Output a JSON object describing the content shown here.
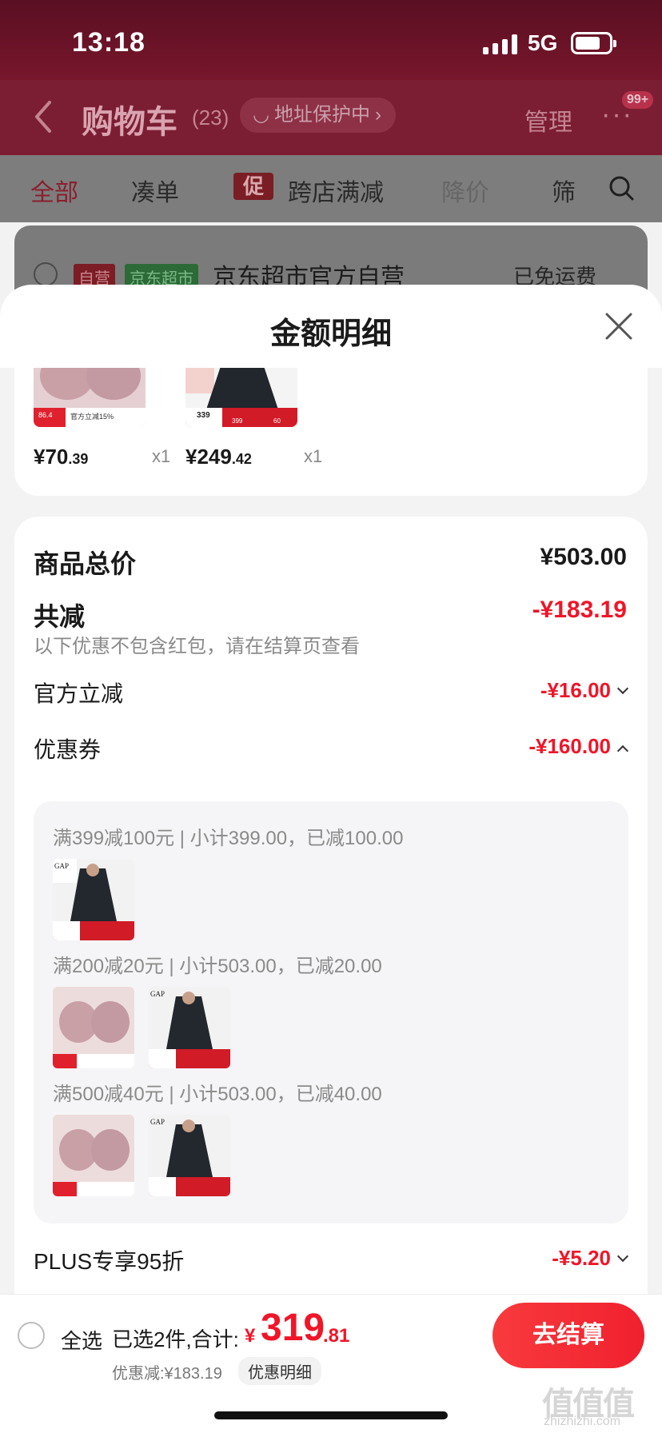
{
  "status": {
    "time": "13:18",
    "network": "5G"
  },
  "cart": {
    "title": "购物车",
    "count": "(23)",
    "address_protect": "地址保护中",
    "manage": "管理",
    "badge": "99+",
    "filters": {
      "all": "全部",
      "cou": "凑单",
      "promo_tag": "促",
      "cross_shop": "跨店满减",
      "price_drop": "降价",
      "screen": "筛"
    },
    "shop": {
      "tag_ziying": "自营",
      "tag_jd": "京东超市",
      "name": "京东超市官方自营",
      "free_shipping": "已免运费"
    }
  },
  "sheet": {
    "title": "金额明细",
    "products": [
      {
        "price_int": "¥70",
        "price_dec": ".39",
        "qty": "x1",
        "thumb_price": "86.4",
        "thumb_text": "官方立减15%"
      },
      {
        "price_int": "¥249",
        "price_dec": ".42",
        "qty": "x1",
        "thumb_price": "339",
        "thumb_a": "399",
        "thumb_b": "60"
      }
    ],
    "goods_total_label": "商品总价",
    "goods_total_value": "¥503.00",
    "total_reduce_label": "共减",
    "total_reduce_value": "-¥183.19",
    "reduce_note": "以下优惠不包含红包，请在结算页查看",
    "official_label": "官方立减",
    "official_value": "-¥16.00",
    "coupon_label": "优惠券",
    "coupon_value": "-¥160.00",
    "coupon_rules": [
      "满399减100元 | 小计399.00，已减100.00",
      "满200减20元 | 小计503.00，已减20.00",
      "满500减40元 | 小计503.00，已减40.00"
    ],
    "plus_label": "PLUS专享95折",
    "plus_value": "-¥5.20"
  },
  "bottom": {
    "select_all": "全选",
    "summary": "已选2件,合计:",
    "total_yen": "¥",
    "total_int": "319",
    "total_dec": ".81",
    "discount": "优惠减:¥183.19",
    "detail_pill": "优惠明细",
    "checkout": "去结算",
    "watermark": "值值值",
    "watermark_sub": "zhizhizhi.com"
  },
  "colors": {
    "accent_red": "#f01528",
    "header_dim": "#7c1e33"
  },
  "icons": [
    "back-icon",
    "search-icon",
    "close-icon",
    "chevron-down-icon",
    "chevron-up-icon",
    "more-icon"
  ]
}
